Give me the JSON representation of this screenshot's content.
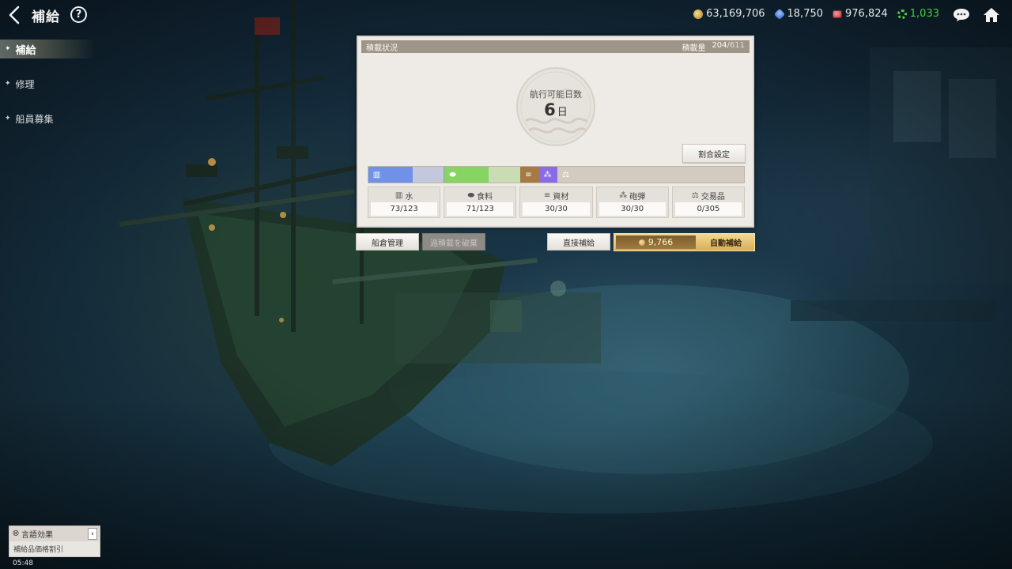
{
  "header": {
    "title": "補給",
    "help_label": "?"
  },
  "currencies": [
    {
      "icon": "gold-coin-icon",
      "value": "63,169,706"
    },
    {
      "icon": "blue-gem-icon",
      "value": "18,750"
    },
    {
      "icon": "red-gem-icon",
      "value": "976,824"
    },
    {
      "icon": "green-gear-icon",
      "value": "1,033",
      "color": "#3fd13a"
    }
  ],
  "sidebar": {
    "items": [
      {
        "label": "補給",
        "active": true
      },
      {
        "label": "修理",
        "active": false
      },
      {
        "label": "船員募集",
        "active": false
      }
    ]
  },
  "panel": {
    "title": "積載状況",
    "capacity_label": "積載量",
    "capacity_used": "204",
    "capacity_max": "/611",
    "days_label": "航行可能日数",
    "days_value": "6",
    "days_unit": "日",
    "ratio_button": "割合設定",
    "bar_colors": {
      "water": "#6f92e8",
      "food": "#86d562",
      "materials": "#a77a45",
      "ammo": "#8b6ae6"
    },
    "cards": [
      {
        "label": "水",
        "icon": "water-bucket-icon",
        "value": "73/123"
      },
      {
        "label": "食料",
        "icon": "bread-icon",
        "value": "71/123"
      },
      {
        "label": "資材",
        "icon": "lumber-icon",
        "value": "30/30"
      },
      {
        "label": "砲弾",
        "icon": "cannonball-icon",
        "value": "30/30"
      },
      {
        "label": "交易品",
        "icon": "scale-icon",
        "value": "0/305"
      }
    ]
  },
  "actions": {
    "hold_management": "船倉管理",
    "discard_overload": "過積載を破棄",
    "direct_supply": "直接補給",
    "auto_supply_cost": "9,766",
    "auto_supply": "自動補給"
  },
  "language_effect": {
    "title": "言語効果",
    "description": "補給品価格割引"
  },
  "clock": "05:48"
}
